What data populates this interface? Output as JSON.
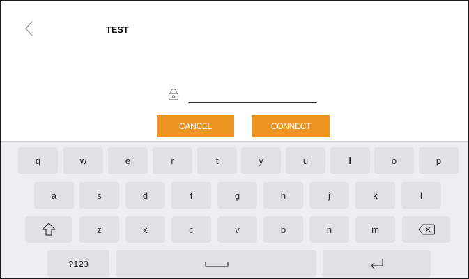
{
  "header": {
    "title": "TEST"
  },
  "password_field": {
    "value": ""
  },
  "buttons": {
    "cancel": "CANCEL",
    "connect": "CONNECT"
  },
  "colors": {
    "button_bg": "#ec9523",
    "key_bg": "#dfe2e5",
    "keyboard_bg": "#eceef0"
  },
  "keyboard": {
    "row1": [
      "q",
      "w",
      "e",
      "r",
      "t",
      "y",
      "u",
      "I",
      "o",
      "p"
    ],
    "row2": [
      "a",
      "s",
      "d",
      "f",
      "g",
      "h",
      "j",
      "k",
      "l"
    ],
    "row3": [
      "z",
      "x",
      "c",
      "v",
      "b",
      "n",
      "m"
    ],
    "symbols_key": "?123",
    "icons": [
      "shift-icon",
      "backspace-icon",
      "space-icon",
      "enter-icon",
      "lock-icon",
      "back-chevron-icon"
    ]
  }
}
